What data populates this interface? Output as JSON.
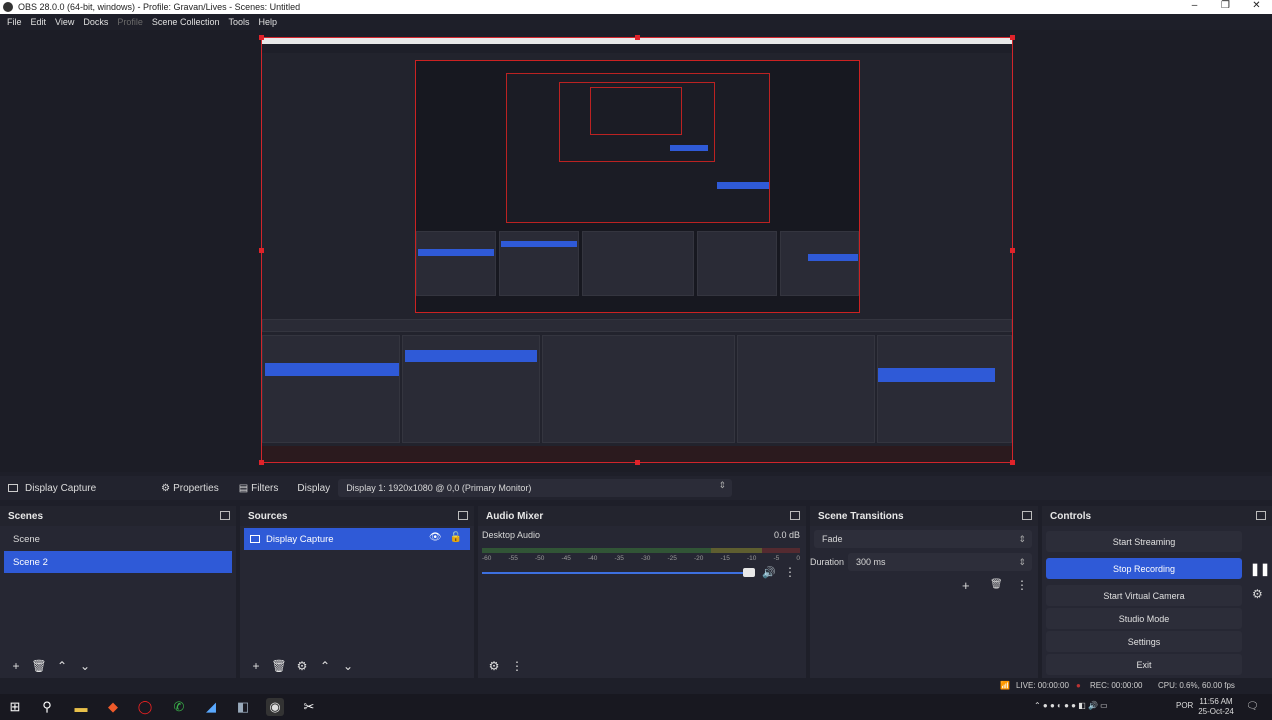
{
  "window": {
    "title": "OBS 28.0.0 (64-bit, windows) - Profile: Gravan/Lives - Scenes: Untitled",
    "controls": [
      "–",
      "❐",
      "✕"
    ]
  },
  "menu": [
    "File",
    "Edit",
    "View",
    "Docks",
    "Profile",
    "Scene Collection",
    "Tools",
    "Help"
  ],
  "toolbar": {
    "source_name": "Display Capture",
    "properties_label": "Properties",
    "filters_label": "Filters",
    "display_label": "Display",
    "display_value": "Display 1: 1920x1080 @ 0,0 (Primary Monitor)"
  },
  "scenes": {
    "title": "Scenes",
    "items": [
      "Scene",
      "Scene 2"
    ],
    "selected_index": 1
  },
  "sources": {
    "title": "Sources",
    "items": [
      "Display Capture"
    ]
  },
  "audio_mixer": {
    "title": "Audio Mixer",
    "channel_name": "Desktop Audio",
    "level": "0.0 dB",
    "ticks": [
      "-60",
      "-55",
      "-50",
      "-45",
      "-40",
      "-35",
      "-30",
      "-25",
      "-20",
      "-15",
      "-10",
      "-5",
      "0"
    ]
  },
  "scene_transitions": {
    "title": "Scene Transitions",
    "transition": "Fade",
    "duration_label": "Duration",
    "duration_value": "300 ms"
  },
  "controls": {
    "title": "Controls",
    "start_streaming": "Start Streaming",
    "stop_recording": "Stop Recording",
    "start_virtual_camera": "Start Virtual Camera",
    "studio_mode": "Studio Mode",
    "settings": "Settings",
    "exit": "Exit"
  },
  "status": {
    "live": "LIVE: 00:00:00",
    "rec": "REC: 00:00:00",
    "cpu": "CPU: 0.6%, 60.00 fps"
  },
  "taskbar": {
    "time": "11:56 AM",
    "date": "25-Oct-24",
    "lang": "POR"
  },
  "colors": {
    "accent": "#2f5ad7",
    "capture_border": "#d0252b",
    "background": "#1e1f29",
    "dock": "#262733"
  }
}
